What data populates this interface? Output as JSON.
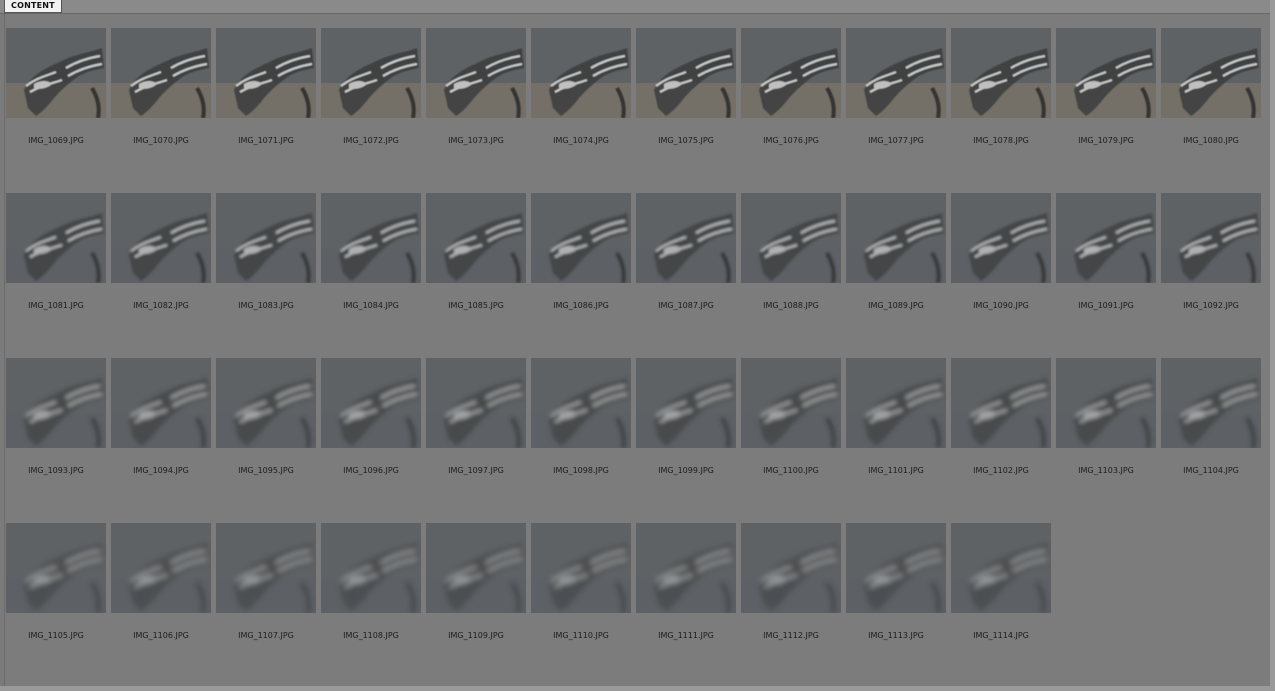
{
  "tab_label": "CONTENT",
  "thumbnail_icon": "eagle-relief-photo",
  "files": [
    "IMG_1069.JPG",
    "IMG_1070.JPG",
    "IMG_1071.JPG",
    "IMG_1072.JPG",
    "IMG_1073.JPG",
    "IMG_1074.JPG",
    "IMG_1075.JPG",
    "IMG_1076.JPG",
    "IMG_1077.JPG",
    "IMG_1078.JPG",
    "IMG_1079.JPG",
    "IMG_1080.JPG",
    "IMG_1081.JPG",
    "IMG_1082.JPG",
    "IMG_1083.JPG",
    "IMG_1084.JPG",
    "IMG_1085.JPG",
    "IMG_1086.JPG",
    "IMG_1087.JPG",
    "IMG_1088.JPG",
    "IMG_1089.JPG",
    "IMG_1090.JPG",
    "IMG_1091.JPG",
    "IMG_1092.JPG",
    "IMG_1093.JPG",
    "IMG_1094.JPG",
    "IMG_1095.JPG",
    "IMG_1096.JPG",
    "IMG_1097.JPG",
    "IMG_1098.JPG",
    "IMG_1099.JPG",
    "IMG_1100.JPG",
    "IMG_1101.JPG",
    "IMG_1102.JPG",
    "IMG_1103.JPG",
    "IMG_1104.JPG",
    "IMG_1105.JPG",
    "IMG_1106.JPG",
    "IMG_1107.JPG",
    "IMG_1108.JPG",
    "IMG_1109.JPG",
    "IMG_1110.JPG",
    "IMG_1111.JPG",
    "IMG_1112.JPG",
    "IMG_1113.JPG",
    "IMG_1114.JPG"
  ]
}
